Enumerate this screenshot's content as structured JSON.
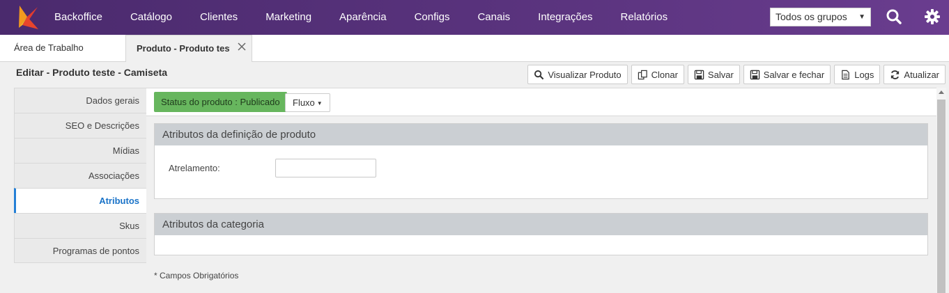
{
  "nav": {
    "items": [
      "Backoffice",
      "Catálogo",
      "Clientes",
      "Marketing",
      "Aparência",
      "Configs",
      "Canais",
      "Integrações",
      "Relatórios"
    ],
    "group_select": "Todos os grupos"
  },
  "tabs": {
    "home": "Área de Trabalho",
    "active": "Produto - Produto teste - Camiseta"
  },
  "page": {
    "title": "Editar - Produto teste - Camiseta"
  },
  "toolbar": {
    "view": "Visualizar Produto",
    "clone": "Clonar",
    "save": "Salvar",
    "save_close": "Salvar e fechar",
    "logs": "Logs",
    "refresh": "Atualizar"
  },
  "sidebar": {
    "items": [
      "Dados gerais",
      "SEO e Descrições",
      "Mídias",
      "Associações",
      "Atributos",
      "Skus",
      "Programas de pontos"
    ]
  },
  "main": {
    "status": "Status do produto : Publicado",
    "fluxo": "Fluxo",
    "panel1_title": "Atributos da definição de produto",
    "field_label": "Atrelamento:",
    "field_value": "",
    "panel2_title": "Atributos da categoria",
    "required_note": "* Campos Obrigatórios"
  },
  "colors": {
    "nav_bg": "#5b347f",
    "status_green": "#67b65e",
    "active_blue": "#1a73c8"
  }
}
